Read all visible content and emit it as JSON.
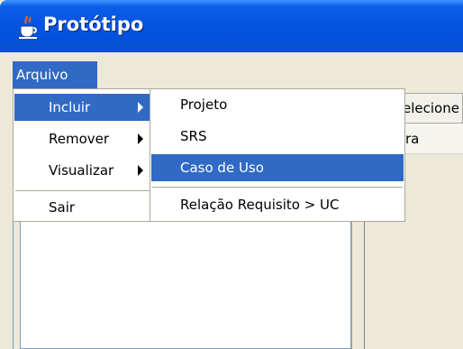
{
  "window": {
    "title": "Protótipo",
    "icon": "java-cup-icon"
  },
  "menubar": {
    "arquivo_label": "Arquivo"
  },
  "menu_arquivo": {
    "items": [
      {
        "label": "Incluir",
        "submenu": true,
        "active": true
      },
      {
        "label": "Remover",
        "submenu": true
      },
      {
        "label": "Visualizar",
        "submenu": true
      },
      {
        "label": "Sair",
        "submenu": false
      }
    ]
  },
  "menu_incluir": {
    "items": [
      {
        "label": "Projeto"
      },
      {
        "label": "SRS"
      },
      {
        "label": "Caso de Uso",
        "active": true
      },
      {
        "label": "Relação Requisito > UC"
      }
    ]
  },
  "right_panel": {
    "header_text": "elecione",
    "row_text": "ra"
  },
  "colors": {
    "titlebar": "#0654e2",
    "highlight": "#316ac5",
    "face": "#ece9d8"
  }
}
